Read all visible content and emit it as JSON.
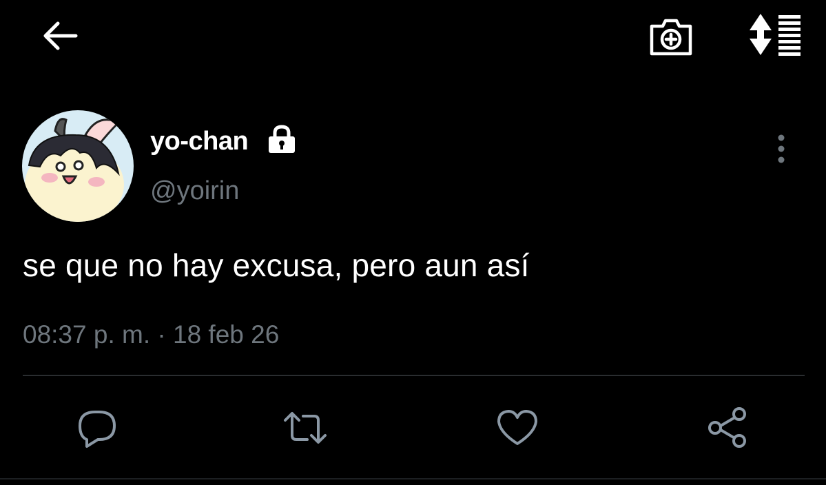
{
  "header": {
    "display_name": "yo-chan",
    "handle": "@yoirin"
  },
  "tweet": {
    "text": "se que no hay excusa, pero aun así",
    "time": "08:37 p. m.",
    "separator": "·",
    "date": "18 feb 26"
  },
  "colors": {
    "background": "#000000",
    "text": "#ffffff",
    "secondary_text": "#6e767d",
    "icon": "#8b98a5",
    "divider": "#2a2d30"
  },
  "icons": {
    "back": "arrow-left-icon",
    "camera": "camera-icon",
    "sort": "sort-icon",
    "lock": "lock-icon",
    "more": "more-vertical-icon",
    "reply": "reply-icon",
    "retweet": "retweet-icon",
    "like": "heart-icon",
    "share": "share-icon"
  }
}
